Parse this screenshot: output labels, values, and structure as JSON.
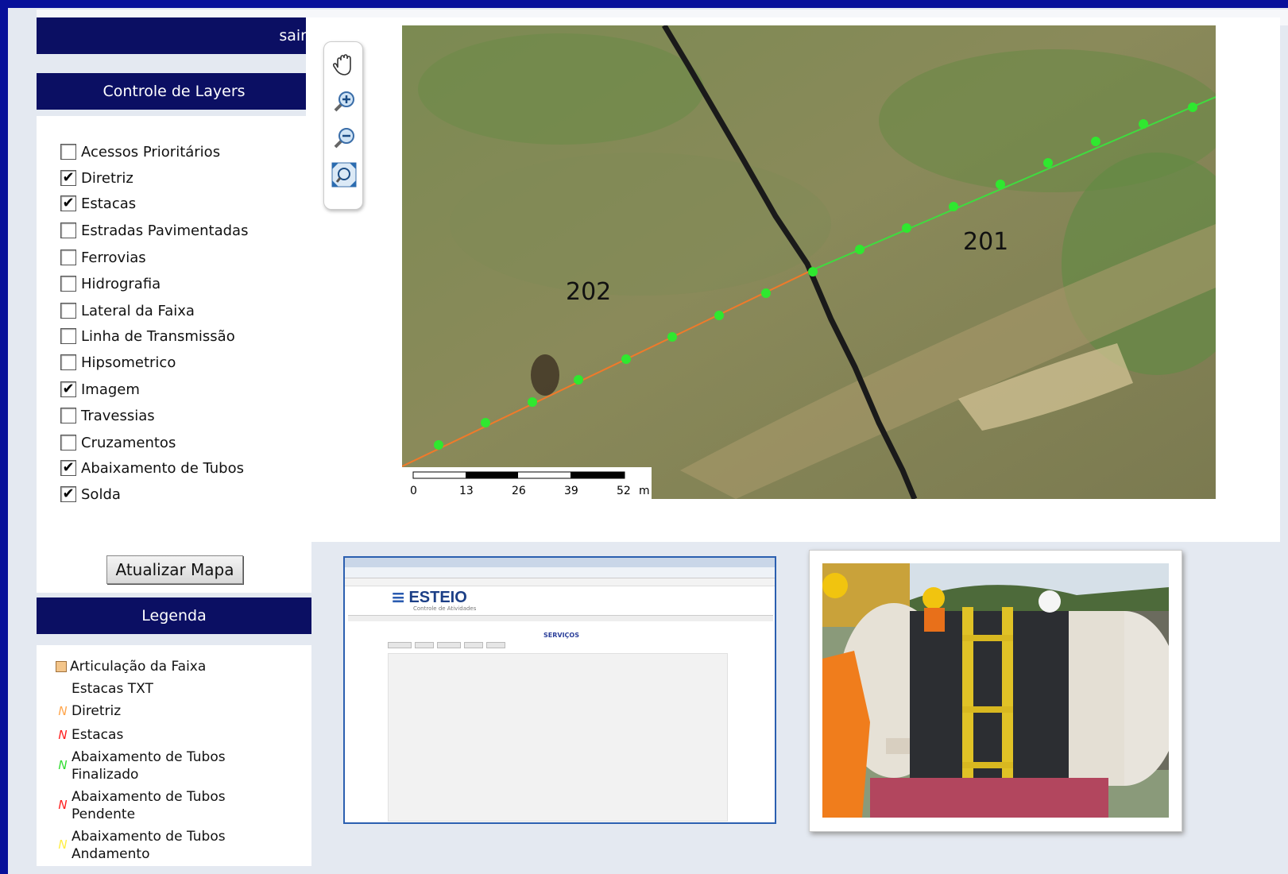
{
  "header": {
    "logout": "sair"
  },
  "layers": {
    "title": "Controle de Layers",
    "items": [
      {
        "label": "Acessos Prioritários",
        "checked": false
      },
      {
        "label": "Diretriz",
        "checked": true
      },
      {
        "label": "Estacas",
        "checked": true
      },
      {
        "label": "Estradas Pavimentadas",
        "checked": false
      },
      {
        "label": "Ferrovias",
        "checked": false
      },
      {
        "label": "Hidrografia",
        "checked": false
      },
      {
        "label": "Lateral da Faixa",
        "checked": false
      },
      {
        "label": "Linha de Transmissão",
        "checked": false
      },
      {
        "label": "Hipsometrico",
        "checked": false
      },
      {
        "label": "Imagem",
        "checked": true
      },
      {
        "label": "Travessias",
        "checked": false
      },
      {
        "label": "Cruzamentos",
        "checked": false
      },
      {
        "label": "Abaixamento de Tubos",
        "checked": true
      },
      {
        "label": "Solda",
        "checked": true
      }
    ],
    "update_button": "Atualizar Mapa"
  },
  "legend": {
    "title": "Legenda",
    "items": [
      {
        "label": "Articulação da Faixa",
        "symbol": "box",
        "color": "#f3c58a"
      },
      {
        "label": "Estacas TXT",
        "symbol": "none",
        "color": ""
      },
      {
        "label": "Diretriz",
        "symbol": "line",
        "color": "#ffa64d"
      },
      {
        "label": "Estacas",
        "symbol": "line",
        "color": "#ff2020"
      },
      {
        "label": "Abaixamento de Tubos Finalizado",
        "symbol": "line",
        "color": "#33dd33"
      },
      {
        "label": "Abaixamento de Tubos Pendente",
        "symbol": "line",
        "color": "#ff2020"
      },
      {
        "label": "Abaixamento de Tubos Andamento",
        "symbol": "line",
        "color": "#ffee44"
      }
    ]
  },
  "map": {
    "labels": [
      "202",
      "201"
    ],
    "scale": {
      "ticks": [
        "0",
        "13",
        "26",
        "39",
        "52"
      ],
      "unit": "m"
    },
    "tools": [
      "pan-hand-icon",
      "zoom-in-icon",
      "zoom-out-icon",
      "zoom-extent-icon"
    ]
  },
  "thumbnail": {
    "logo": "ESTEIO",
    "logo_sub": "Controle de Atividades",
    "section": "SERVIÇOS"
  }
}
